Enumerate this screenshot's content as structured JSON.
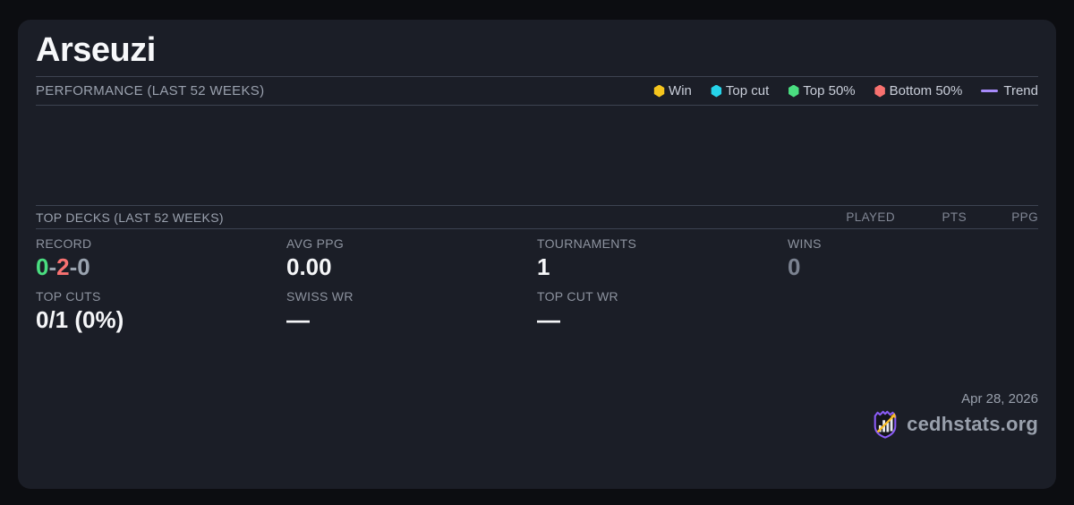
{
  "card": {
    "title": "Arseuzi"
  },
  "performance": {
    "heading": "PERFORMANCE (LAST 52 WEEKS)",
    "legend": [
      {
        "label": "Win",
        "color": "#f5c51d",
        "marker": "hexagon"
      },
      {
        "label": "Top cut",
        "color": "#26d3e9",
        "marker": "hexagon"
      },
      {
        "label": "Top 50%",
        "color": "#4ade80",
        "marker": "hexagon"
      },
      {
        "label": "Bottom 50%",
        "color": "#f8716f",
        "marker": "hexagon"
      },
      {
        "label": "Trend",
        "color": "#a78bfa",
        "marker": "line"
      }
    ],
    "chart_empty": true
  },
  "top_decks": {
    "heading": "TOP DECKS (LAST 52 WEEKS)",
    "columns": [
      "PLAYED",
      "PTS",
      "PPG"
    ],
    "rows": []
  },
  "stats": {
    "record": {
      "label": "RECORD",
      "wins": "0",
      "losses": "2",
      "draws": "0",
      "sep": "-",
      "wins_color": "#4ade80",
      "losses_color": "#f87171",
      "neutral_color": "#9aa3af"
    },
    "avg_ppg": {
      "label": "AVG PPG",
      "value": "0.00"
    },
    "tournaments": {
      "label": "TOURNAMENTS",
      "value": "1"
    },
    "wins": {
      "label": "WINS",
      "value": "0",
      "value_color": "#7b8290"
    },
    "top_cuts": {
      "label": "TOP CUTS",
      "value": "0/1 (0%)"
    },
    "swiss_wr": {
      "label": "SWISS WR",
      "value": "—"
    },
    "top_cut_wr": {
      "label": "TOP CUT WR",
      "value": "—"
    }
  },
  "footer": {
    "date": "Apr 28, 2026",
    "brand": "cedhstats.org"
  },
  "theme": {
    "page_bg": "#0c0d11",
    "card_bg": "#1b1e27",
    "divider": "#3d4351",
    "label_text": "#8d939f",
    "value_text": "#f5f6f8",
    "muted_value": "#7b8290",
    "logo_purple": "#8b5cf6",
    "logo_gold": "#fbbf24"
  }
}
